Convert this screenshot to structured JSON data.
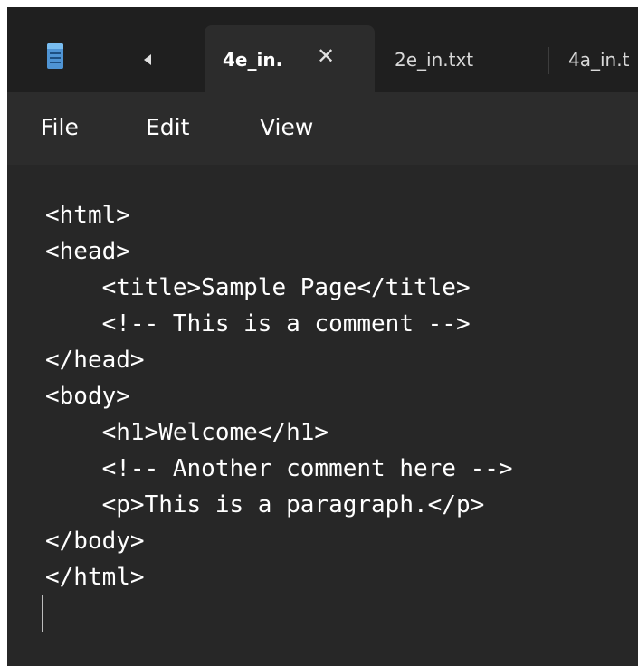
{
  "tabs": [
    {
      "label": "4e_in.",
      "active": true,
      "close_glyph": "✕"
    },
    {
      "label": "2e_in.txt",
      "active": false
    },
    {
      "label": "4a_in.t",
      "active": false
    }
  ],
  "icons": {
    "app": "notepad-icon",
    "back": "chevron-left-icon",
    "close": "close-icon"
  },
  "menu": {
    "items": [
      "File",
      "Edit",
      "View"
    ]
  },
  "editor": {
    "lines": [
      "<html>",
      "<head>",
      "    <title>Sample Page</title>",
      "    <!-- This is a comment -->",
      "</head>",
      "<body>",
      "    <h1>Welcome</h1>",
      "    <!-- Another comment here -->",
      "    <p>This is a paragraph.</p>",
      "</body>",
      "</html>"
    ]
  },
  "colors": {
    "titlebar_bg": "#1f1f1f",
    "menubar_bg": "#2c2c2c",
    "editor_bg": "#272727",
    "text": "#ffffff"
  }
}
